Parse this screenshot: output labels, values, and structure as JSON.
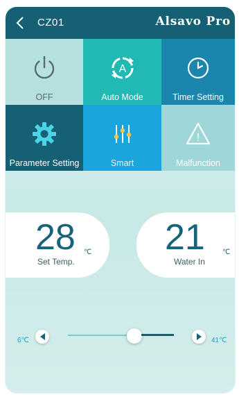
{
  "header": {
    "device_name": "CZ01",
    "brand": "Alsavo Pro"
  },
  "tiles": {
    "off": {
      "label": "OFF",
      "icon": "power-icon"
    },
    "auto": {
      "label": "Auto Mode",
      "icon": "auto-mode-icon",
      "glyph": "A"
    },
    "timer": {
      "label": "Timer Setting",
      "icon": "clock-icon"
    },
    "parameter": {
      "label": "Parameter Setting",
      "icon": "gear-icon"
    },
    "smart": {
      "label": "Smart",
      "icon": "sliders-icon"
    },
    "malfunction": {
      "label": "Malfunction",
      "icon": "warning-icon",
      "glyph": "!"
    }
  },
  "set_temp": {
    "value": "28",
    "unit": "℃",
    "label": "Set Temp."
  },
  "water_in": {
    "value": "21",
    "unit": "℃",
    "label": "Water In"
  },
  "slider": {
    "min_label": "6℃",
    "max_label": "41℃"
  },
  "colors": {
    "header": "#166076",
    "accent": "#20b9b3",
    "primary_text": "#17637b"
  }
}
